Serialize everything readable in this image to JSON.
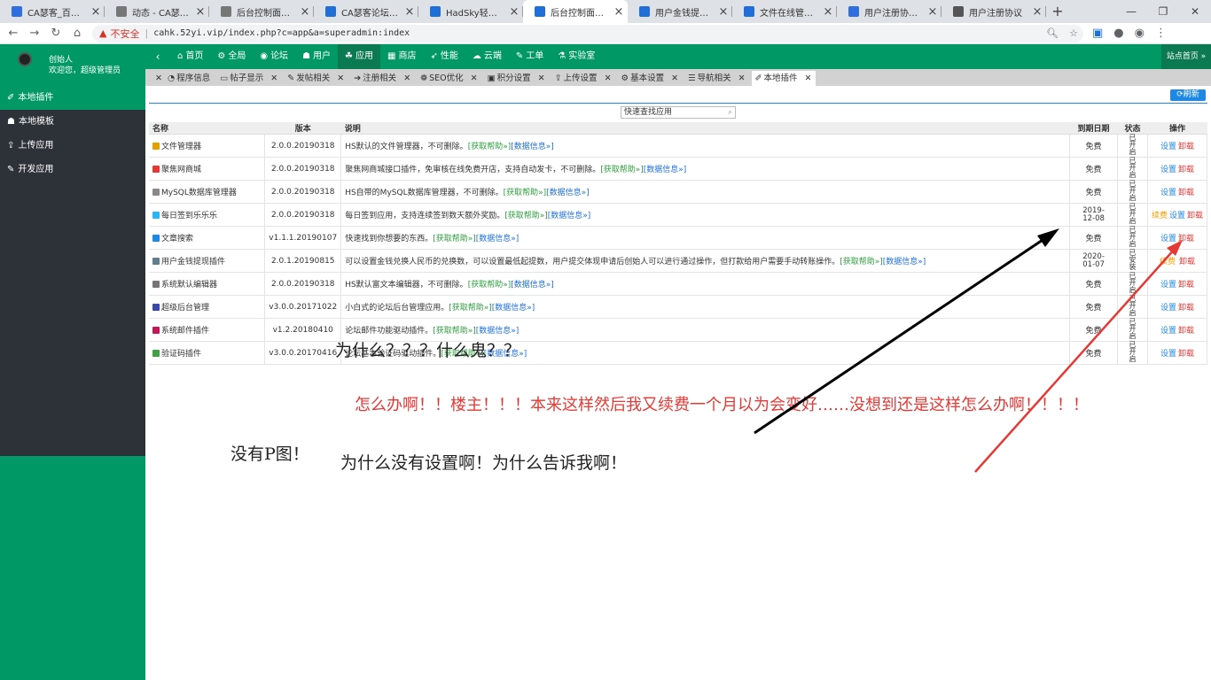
{
  "browser": {
    "tabs": [
      {
        "title": "CA瑟客_百度搜索",
        "color": "#2f6fe0"
      },
      {
        "title": "动态 - CA瑟客 - P",
        "color": "#777"
      },
      {
        "title": "后台控制面板 - Po",
        "color": "#777"
      },
      {
        "title": "CA瑟客论坛 - CA瑟",
        "color": "#1e6fd9"
      },
      {
        "title": "HadSky轻论坛官方网",
        "color": "#1e6fd9"
      },
      {
        "title": "后台控制面板 - Po",
        "color": "#1e6fd9",
        "active": true
      },
      {
        "title": "用户金钱提现插件",
        "color": "#1e6fd9"
      },
      {
        "title": "文件在线管理器 -",
        "color": "#1e6fd9"
      },
      {
        "title": "用户注册协议_百度",
        "color": "#2f6fe0"
      },
      {
        "title": "用户注册协议",
        "color": "#555"
      }
    ],
    "new_tab": "+",
    "not_secure": "不安全",
    "url_sep": "|",
    "url": "cahk.52yi.vip/index.php?c=app&a=superadmin:index"
  },
  "admin": {
    "user_name": "创始人",
    "welcome": "欢迎您，超级管理员",
    "site_home": "站点首页 »",
    "top_nav": [
      {
        "icon": "⌂",
        "label": "首页"
      },
      {
        "icon": "⚙",
        "label": "全局"
      },
      {
        "icon": "◉",
        "label": "论坛"
      },
      {
        "icon": "☗",
        "label": "用户"
      },
      {
        "icon": "☘",
        "label": "应用",
        "active": true
      },
      {
        "icon": "▦",
        "label": "商店"
      },
      {
        "icon": "➶",
        "label": "性能"
      },
      {
        "icon": "☁",
        "label": "云端"
      },
      {
        "icon": "✎",
        "label": "工单"
      },
      {
        "icon": "⚗",
        "label": "实验室"
      }
    ],
    "sub_tabs": [
      {
        "icon": "◔",
        "label": "程序信息"
      },
      {
        "icon": "▭",
        "label": "帖子显示"
      },
      {
        "icon": "✎",
        "label": "发帖相关"
      },
      {
        "icon": "➔",
        "label": "注册相关"
      },
      {
        "icon": "❁",
        "label": "SEO优化"
      },
      {
        "icon": "▣",
        "label": "积分设置"
      },
      {
        "icon": "⇪",
        "label": "上传设置"
      },
      {
        "icon": "⚙",
        "label": "基本设置"
      },
      {
        "icon": "☰",
        "label": "导航相关"
      },
      {
        "icon": "✐",
        "label": "本地插件",
        "active": true
      }
    ],
    "sidebar": [
      {
        "icon": "✐",
        "label": "本地插件",
        "active": true
      },
      {
        "icon": "☗",
        "label": "本地模板"
      },
      {
        "icon": "⇪",
        "label": "上传应用"
      },
      {
        "icon": "✎",
        "label": "开发应用"
      }
    ],
    "refresh": "⟳刷新",
    "quick_search_placeholder": "快速查找应用",
    "table": {
      "headers": [
        "名称",
        "版本",
        "说明",
        "到期日期",
        "状态",
        "操作"
      ],
      "help_link": "[获取帮助»]",
      "info_link": "[数据信息»]",
      "rows": [
        {
          "name": "文件管理器",
          "icon_color": "#e0a000",
          "version": "2.0.0.20190318",
          "desc": "HS默认的文件管理器，不可删除。",
          "expire": "免费",
          "status": "已开启",
          "ops": [
            "设置",
            "卸载"
          ]
        },
        {
          "name": "聚焦网商城",
          "icon_color": "#e53935",
          "version": "2.0.0.20190318",
          "desc": "聚焦网商城接口插件，免审核在线免费开店，支持自动发卡，不可删除。",
          "expire": "免费",
          "status": "已开启",
          "ops": [
            "设置",
            "卸载"
          ]
        },
        {
          "name": "MySQL数据库管理器",
          "icon_color": "#888",
          "version": "2.0.0.20190318",
          "desc": "HS自带的MySQL数据库管理器，不可删除。",
          "expire": "免费",
          "status": "已开启",
          "ops": [
            "设置",
            "卸载"
          ]
        },
        {
          "name": "每日签到乐乐乐",
          "icon_color": "#29b6f6",
          "version": "2.0.0.20190318",
          "desc": "每日签到应用，支持连续签到数天额外奖励。",
          "expire": "2019-12-08",
          "status": "已开启",
          "ops": [
            "续费",
            "设置",
            "卸载"
          ]
        },
        {
          "name": "文章搜索",
          "icon_color": "#1e88e5",
          "version": "v1.1.1.20190107",
          "desc": "快速找到你想要的东西。",
          "expire": "免费",
          "status": "已开启",
          "ops": [
            "设置",
            "卸载"
          ]
        },
        {
          "name": "用户金钱提现插件",
          "icon_color": "#607d8b",
          "version": "2.0.1.20190815",
          "desc": "可以设置金钱兑换人民币的兑换数，可以设置最低起提数，用户提交体现申请后创始人可以进行通过操作，但打款给用户需要手动转账操作。",
          "expire": "2020-01-07",
          "status": "已安装",
          "ops": [
            "续费",
            "卸载"
          ]
        },
        {
          "name": "系统默认编辑器",
          "icon_color": "#777",
          "version": "2.0.0.20190318",
          "desc": "HS默认富文本编辑器，不可删除。",
          "expire": "免费",
          "status": "已开启",
          "ops": [
            "设置",
            "卸载"
          ]
        },
        {
          "name": "超级后台管理",
          "icon_color": "#3949ab",
          "version": "v3.0.0.20171022",
          "desc": "小白式的论坛后台管理应用。",
          "expire": "免费",
          "status": "已开启",
          "ops": [
            "设置",
            "卸载"
          ]
        },
        {
          "name": "系统邮件插件",
          "icon_color": "#c2185b",
          "version": "v1.2.20180410",
          "desc": "论坛邮件功能驱动插件。",
          "expire": "免费",
          "status": "已开启",
          "ops": [
            "设置",
            "卸载"
          ]
        },
        {
          "name": "验证码插件",
          "icon_color": "#43a047",
          "version": "v3.0.0.20170416",
          "desc": "论坛基本验证码驱动插件。",
          "expire": "免费",
          "status": "已开启",
          "ops": [
            "设置",
            "卸载"
          ]
        }
      ]
    }
  },
  "annotations": {
    "q1": "为什么？？？什么鬼？？",
    "q2": "怎么办啊！！楼主！！！本来这样然后我又续费一个月以为会变好……没想到还是这样怎么办啊！！！！",
    "q3": "没有P图！",
    "q4": "为什么没有设置啊！为什么告诉我啊！"
  },
  "colors": {
    "accent": "#009966",
    "sidebar": "#2d3138",
    "arrow_black": "#000000",
    "arrow_red": "#e53935"
  }
}
